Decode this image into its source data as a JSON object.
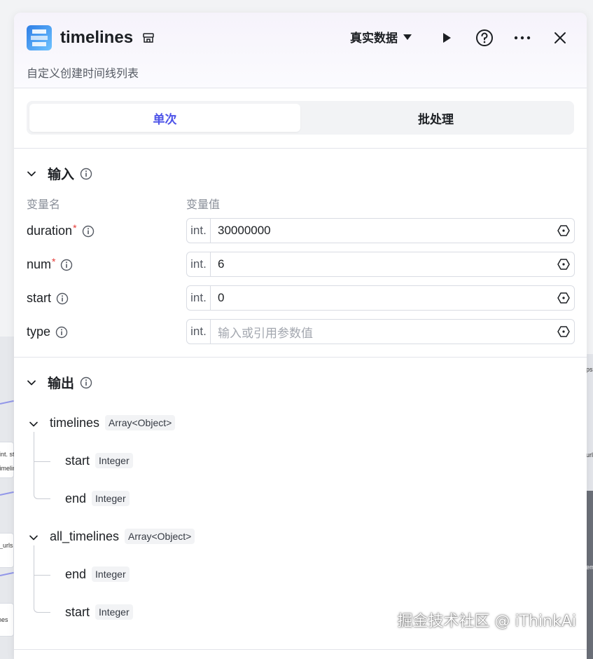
{
  "header": {
    "title": "timelines",
    "subtitle": "自定义创建时间线列表",
    "data_mode_label": "真实数据"
  },
  "tabs": [
    {
      "label": "单次",
      "active": true
    },
    {
      "label": "批处理",
      "active": false
    }
  ],
  "input": {
    "section_title": "输入",
    "col_name_header": "变量名",
    "col_value_header": "变量值",
    "params": [
      {
        "name": "duration",
        "required": true,
        "type": "int.",
        "value": "30000000",
        "placeholder": ""
      },
      {
        "name": "num",
        "required": true,
        "type": "int.",
        "value": "6",
        "placeholder": ""
      },
      {
        "name": "start",
        "required": false,
        "type": "int.",
        "value": "0",
        "placeholder": ""
      },
      {
        "name": "type",
        "required": false,
        "type": "int.",
        "value": "",
        "placeholder": "输入或引用参数值"
      }
    ]
  },
  "output": {
    "section_title": "输出",
    "fields": [
      {
        "name": "timelines",
        "type": "Array<Object>",
        "children": [
          {
            "name": "start",
            "type": "Integer"
          },
          {
            "name": "end",
            "type": "Integer"
          }
        ]
      },
      {
        "name": "all_timelines",
        "type": "Array<Object>",
        "children": [
          {
            "name": "end",
            "type": "Integer"
          },
          {
            "name": "start",
            "type": "Integer"
          }
        ]
      }
    ]
  },
  "background": {
    "left_snippets": [
      "int. st",
      "timelin",
      "_urls",
      "nes"
    ],
    "right_snippets": [
      "ps",
      "url",
      "em"
    ]
  },
  "watermark": "掘金技术社区 @ iThinkAi",
  "colors": {
    "accent": "#4d53e8",
    "required": "#e53935",
    "text": "#1c1f23",
    "muted": "#8a8f99"
  }
}
